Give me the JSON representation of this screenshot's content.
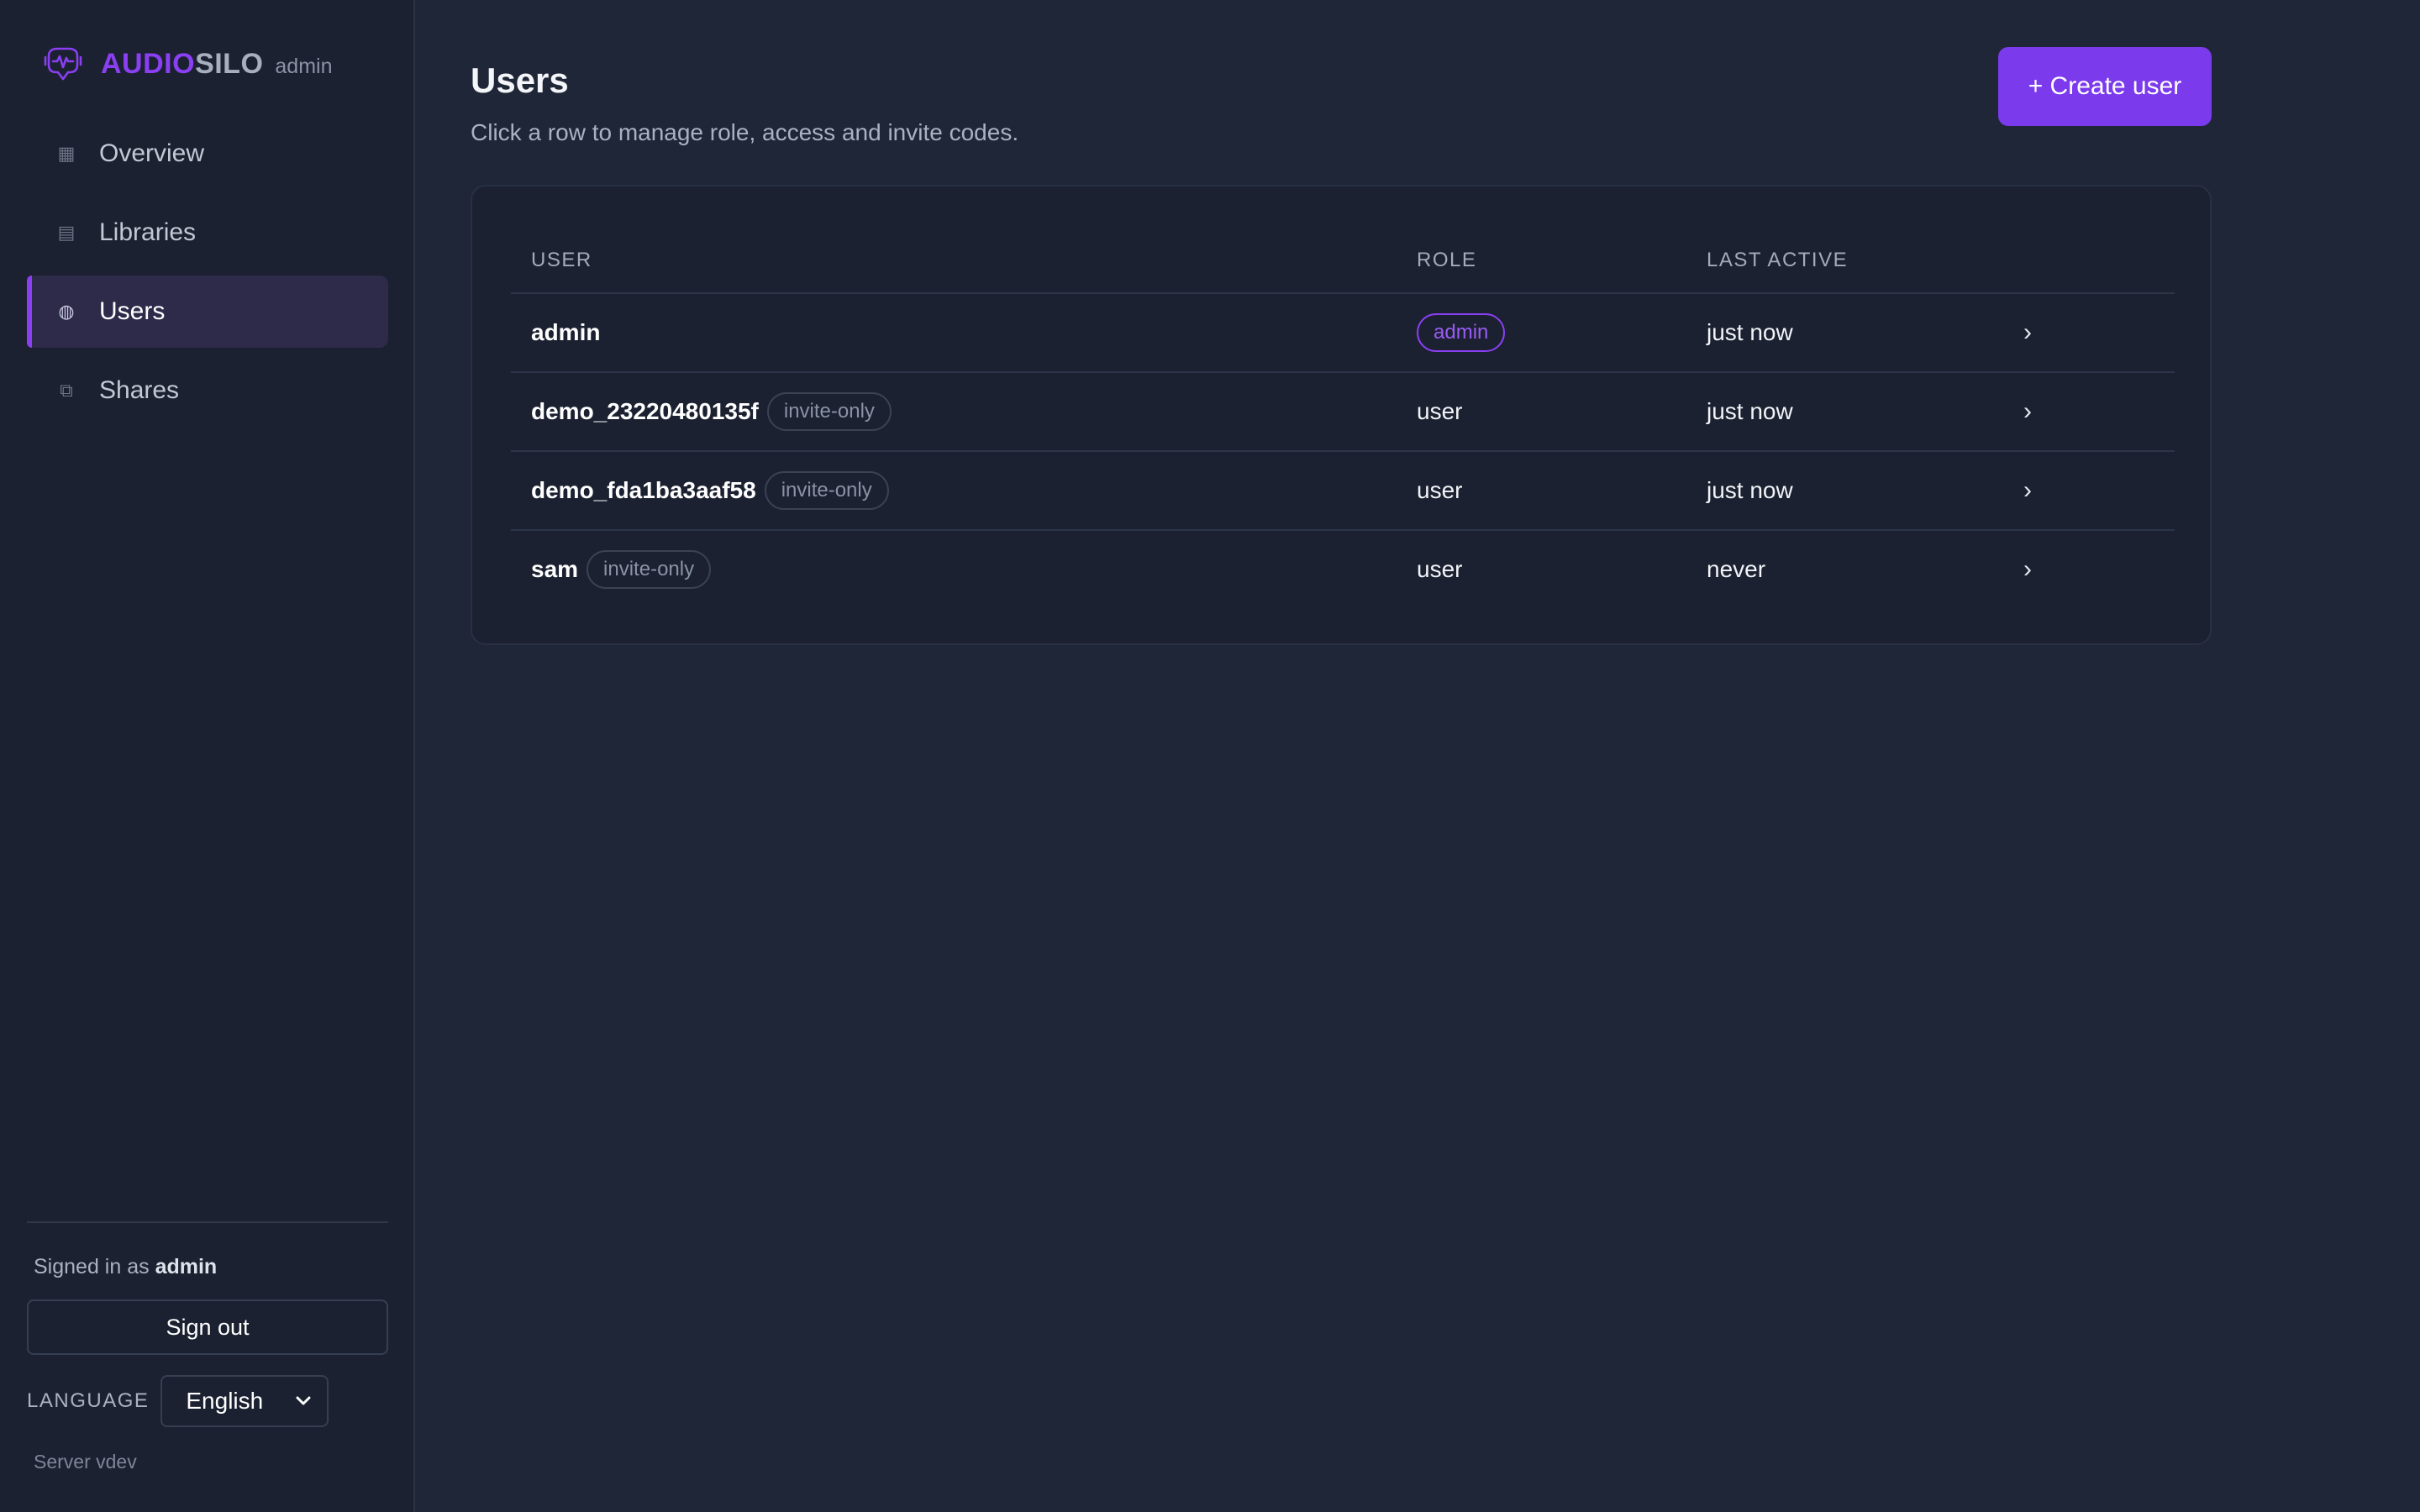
{
  "app": {
    "brand_a": "AUDIO",
    "brand_b": "SILO",
    "role": "admin",
    "accent": "#7c3aed"
  },
  "sidebar": {
    "items": [
      {
        "label": "Overview",
        "icon": "overview-icon",
        "glyph": "▦",
        "active": false
      },
      {
        "label": "Libraries",
        "icon": "libraries-icon",
        "glyph": "▤",
        "active": false
      },
      {
        "label": "Users",
        "icon": "users-icon",
        "glyph": "◍",
        "active": true
      },
      {
        "label": "Shares",
        "icon": "shares-icon",
        "glyph": "⧉",
        "active": false
      }
    ],
    "signed_in_prefix": "Signed in as",
    "signed_in_user": "admin",
    "signout_label": "Sign out",
    "language_label": "LANGUAGE",
    "language_value": "English",
    "server": "Server vdev"
  },
  "main": {
    "title": "Users",
    "subtitle": "Click a row to manage role, access and invite codes.",
    "create_label": "+ Create user",
    "columns": [
      "USER",
      "ROLE",
      "LAST ACTIVE"
    ],
    "rows": [
      {
        "user": "admin",
        "badge": "",
        "role": "admin",
        "last_active": "just now",
        "chevron": "›"
      },
      {
        "user": "demo_23220480135f",
        "badge": "invite-only",
        "role": "user",
        "last_active": "just now",
        "chevron": "›"
      },
      {
        "user": "demo_fda1ba3aaf58",
        "badge": "invite-only",
        "role": "user",
        "last_active": "just now",
        "chevron": "›"
      },
      {
        "user": "sam",
        "badge": "invite-only",
        "role": "user",
        "last_active": "never",
        "chevron": "›"
      }
    ]
  }
}
